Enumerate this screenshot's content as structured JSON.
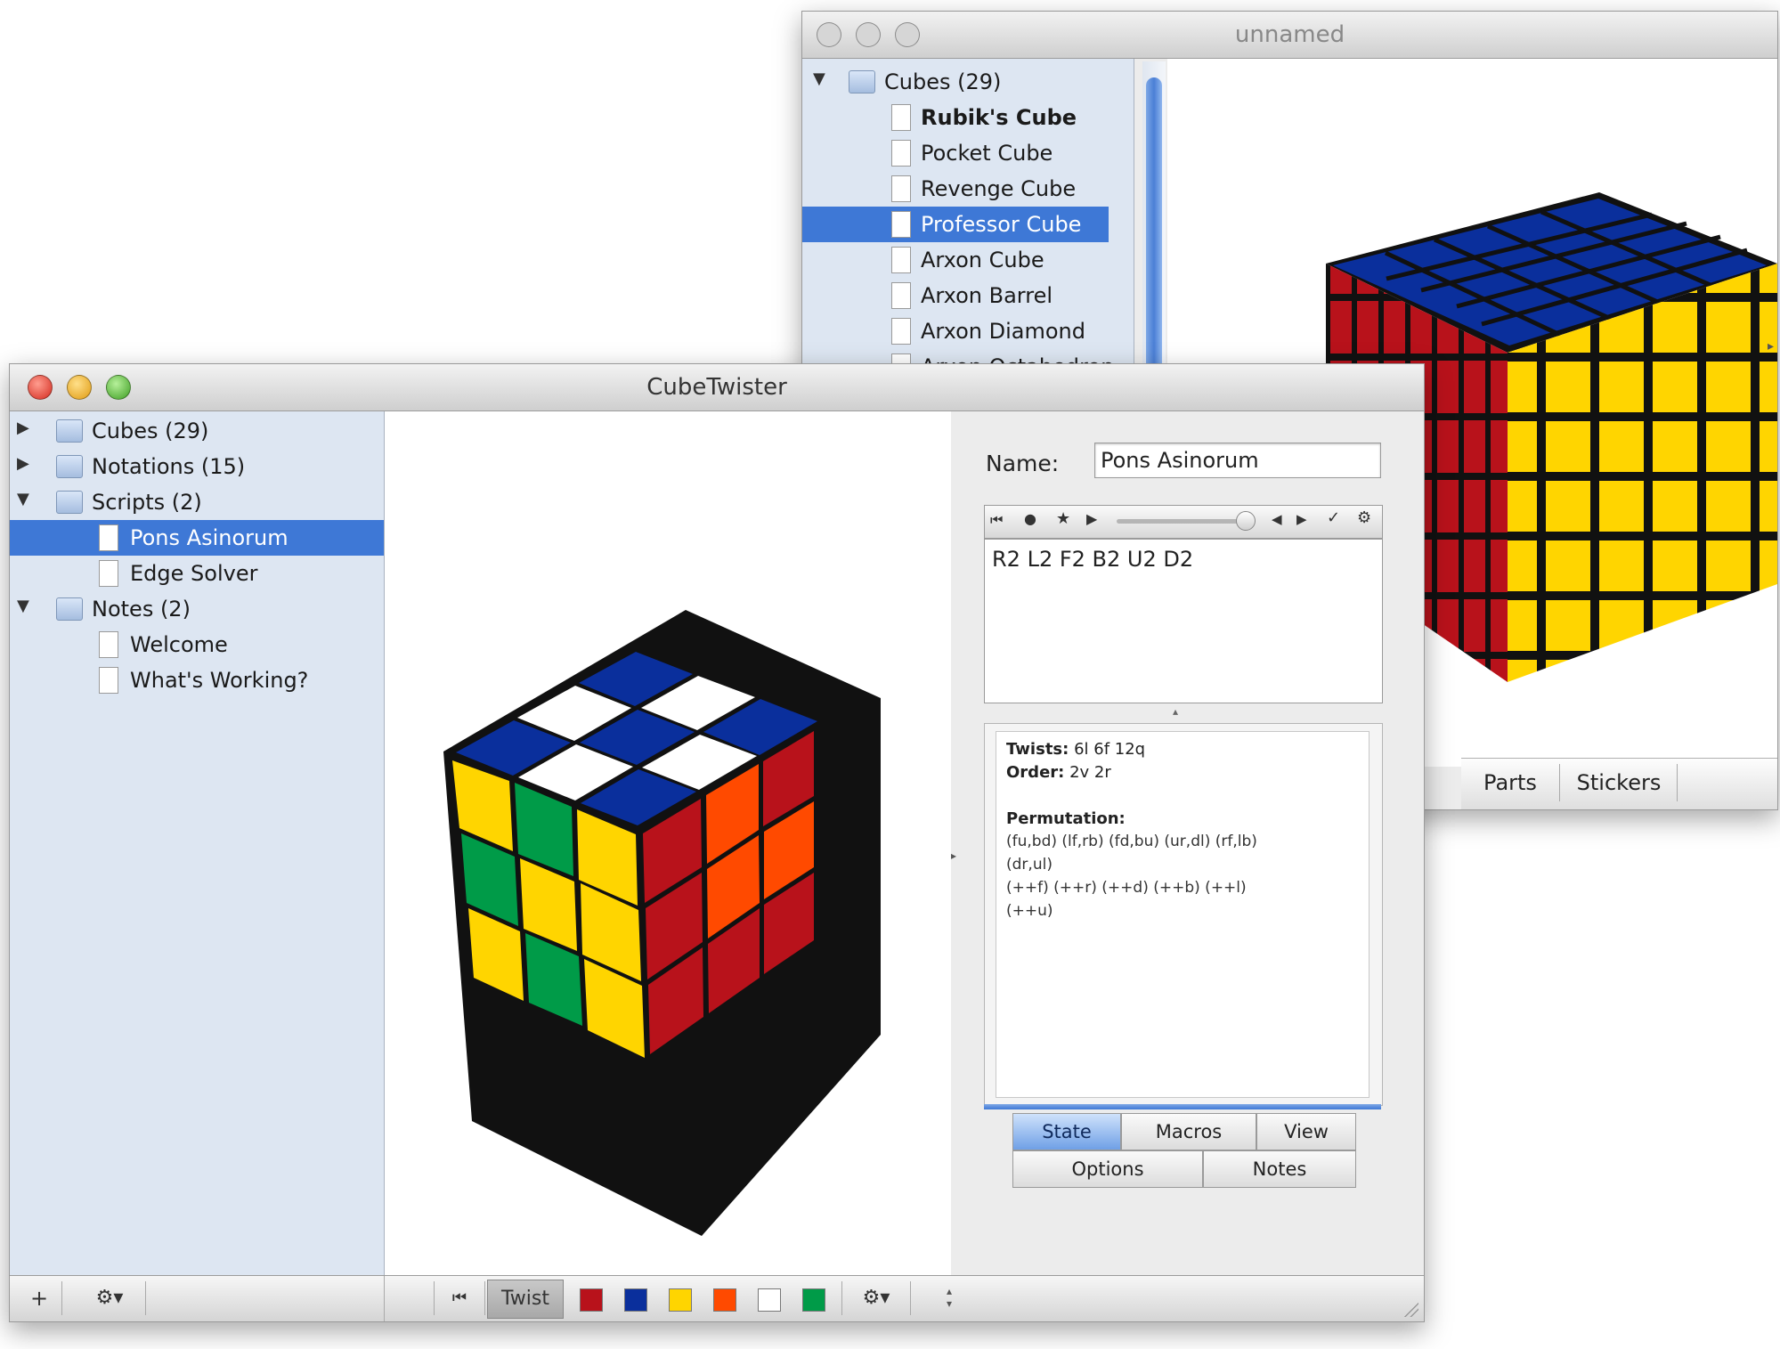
{
  "back_window": {
    "title": "unnamed",
    "tree": {
      "group_label": "Cubes (29)",
      "items": [
        "Rubik's Cube",
        "Pocket Cube",
        "Revenge Cube",
        "Professor Cube",
        "Arxon Cube",
        "Arxon Barrel",
        "Arxon Diamond",
        "Arxon Octahedron"
      ],
      "selected": "Professor Cube"
    },
    "tabs": [
      "Parts",
      "Stickers"
    ]
  },
  "front_window": {
    "title": "CubeTwister",
    "sidebar": {
      "groups": [
        {
          "label": "Cubes (29)",
          "expanded": false
        },
        {
          "label": "Notations (15)",
          "expanded": false
        },
        {
          "label": "Scripts (2)",
          "expanded": true,
          "items": [
            "Pons Asinorum",
            "Edge Solver"
          ]
        },
        {
          "label": "Notes (2)",
          "expanded": true,
          "items": [
            "Welcome",
            "What's Working?"
          ]
        }
      ],
      "selected": "Pons Asinorum"
    },
    "inspector": {
      "name_label": "Name:",
      "name_value": "Pons Asinorum",
      "script_text": "R2 L2 F2 B2 U2 D2",
      "info": {
        "twists_label": "Twists:",
        "twists_value": "6l 6f 12q",
        "order_label": "Order:",
        "order_value": "2v 2r",
        "permutation_label": "Permutation:",
        "permutation_lines": [
          "(fu,bd) (lf,rb) (fd,bu) (ur,dl) (rf,lb)",
          "(dr,ul)",
          "(++f) (++r) (++d) (++b) (++l)",
          "(++u)"
        ]
      },
      "tabs_row1": [
        "State",
        "Macros",
        "View"
      ],
      "tabs_row2": [
        "Options",
        "Notes"
      ],
      "active_tab": "State"
    },
    "bottom_toolbar": {
      "add_icon": "plus-icon",
      "action_icon": "gear-icon",
      "twist_label": "Twist",
      "swatches": [
        "#b8121b",
        "#0a2f9c",
        "#ffd500",
        "#ff4a00",
        "#ffffff",
        "#009b48"
      ]
    }
  },
  "colors": {
    "selection": "#3e78d6",
    "sidebar_bg": "#dde6f2",
    "cube_blue": "#0a2f9c",
    "cube_yellow": "#ffd500",
    "cube_red": "#b8121b",
    "cube_green": "#009b48",
    "cube_orange": "#ff4a00",
    "cube_white": "#ffffff"
  }
}
